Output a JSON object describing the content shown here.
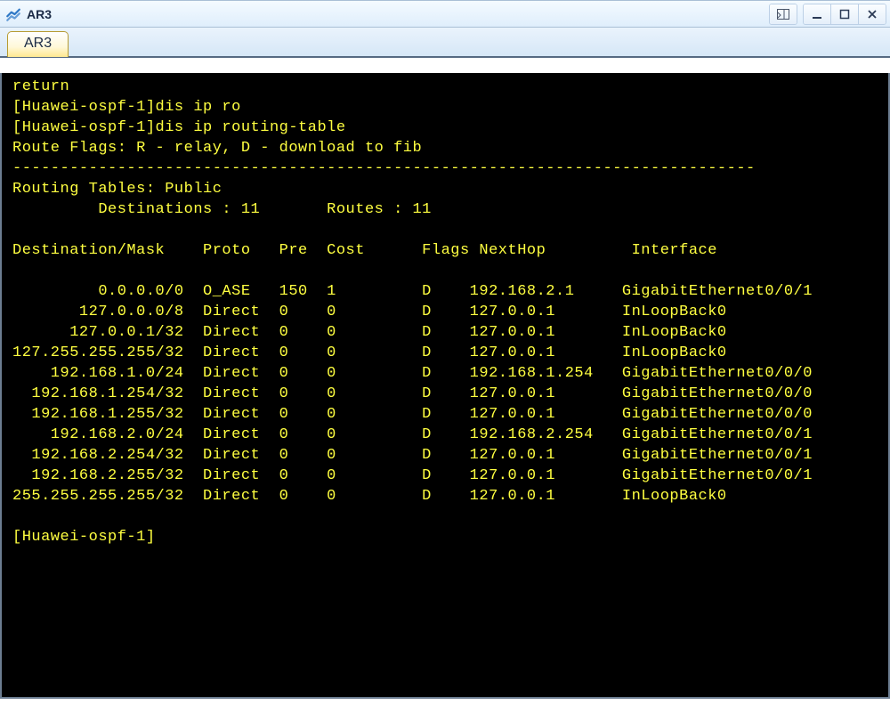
{
  "window": {
    "title": "AR3"
  },
  "tabs": [
    {
      "label": "AR3",
      "active": true
    }
  ],
  "terminal": {
    "lines_before": [
      "return",
      "[Huawei-ospf-1]dis ip ro",
      "[Huawei-ospf-1]dis ip routing-table",
      "Route Flags: R - relay, D - download to fib"
    ],
    "hr": "------------------------------------------------------------------------------",
    "routing_header": "Routing Tables: Public",
    "counts_line": "         Destinations : 11       Routes : 11",
    "destinations": 11,
    "routes_count": 11,
    "columns_line": "Destination/Mask    Proto   Pre  Cost      Flags NextHop         Interface",
    "routes": [
      {
        "dest": "0.0.0.0/0",
        "proto": "O_ASE",
        "pre": 150,
        "cost": 1,
        "flags": "D",
        "nexthop": "192.168.2.1",
        "iface": "GigabitEthernet0/0/1"
      },
      {
        "dest": "127.0.0.0/8",
        "proto": "Direct",
        "pre": 0,
        "cost": 0,
        "flags": "D",
        "nexthop": "127.0.0.1",
        "iface": "InLoopBack0"
      },
      {
        "dest": "127.0.0.1/32",
        "proto": "Direct",
        "pre": 0,
        "cost": 0,
        "flags": "D",
        "nexthop": "127.0.0.1",
        "iface": "InLoopBack0"
      },
      {
        "dest": "127.255.255.255/32",
        "proto": "Direct",
        "pre": 0,
        "cost": 0,
        "flags": "D",
        "nexthop": "127.0.0.1",
        "iface": "InLoopBack0"
      },
      {
        "dest": "192.168.1.0/24",
        "proto": "Direct",
        "pre": 0,
        "cost": 0,
        "flags": "D",
        "nexthop": "192.168.1.254",
        "iface": "GigabitEthernet0/0/0"
      },
      {
        "dest": "192.168.1.254/32",
        "proto": "Direct",
        "pre": 0,
        "cost": 0,
        "flags": "D",
        "nexthop": "127.0.0.1",
        "iface": "GigabitEthernet0/0/0"
      },
      {
        "dest": "192.168.1.255/32",
        "proto": "Direct",
        "pre": 0,
        "cost": 0,
        "flags": "D",
        "nexthop": "127.0.0.1",
        "iface": "GigabitEthernet0/0/0"
      },
      {
        "dest": "192.168.2.0/24",
        "proto": "Direct",
        "pre": 0,
        "cost": 0,
        "flags": "D",
        "nexthop": "192.168.2.254",
        "iface": "GigabitEthernet0/0/1"
      },
      {
        "dest": "192.168.2.254/32",
        "proto": "Direct",
        "pre": 0,
        "cost": 0,
        "flags": "D",
        "nexthop": "127.0.0.1",
        "iface": "GigabitEthernet0/0/1"
      },
      {
        "dest": "192.168.2.255/32",
        "proto": "Direct",
        "pre": 0,
        "cost": 0,
        "flags": "D",
        "nexthop": "127.0.0.1",
        "iface": "GigabitEthernet0/0/1"
      },
      {
        "dest": "255.255.255.255/32",
        "proto": "Direct",
        "pre": 0,
        "cost": 0,
        "flags": "D",
        "nexthop": "127.0.0.1",
        "iface": "InLoopBack0"
      }
    ],
    "prompt_after": "[Huawei-ospf-1]"
  },
  "layout": {
    "dest_col": 18,
    "proto_col": 8,
    "pre_col": 5,
    "cost_col": 4,
    "flags_prefix": "      ",
    "nexthop_col": 16,
    "terminal_width": 94
  }
}
